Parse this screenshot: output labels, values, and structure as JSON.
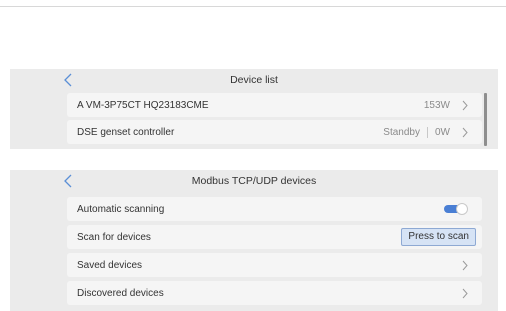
{
  "device_list": {
    "title": "Device list",
    "rows": [
      {
        "label": "A VM-3P75CT HQ23183CME",
        "value": "153W"
      },
      {
        "label": "DSE genset controller",
        "status": "Standby",
        "value": "0W"
      }
    ]
  },
  "modbus": {
    "title": "Modbus TCP/UDP devices",
    "automatic_scanning": {
      "label": "Automatic scanning",
      "enabled": true
    },
    "scan": {
      "label": "Scan for devices",
      "button": "Press to scan"
    },
    "saved": {
      "label": "Saved devices"
    },
    "discovered": {
      "label": "Discovered devices"
    }
  },
  "colors": {
    "accent": "#4a7fd4",
    "panel_bg": "#ebebeb",
    "row_bg": "#f5f5f5"
  },
  "icons": {
    "back": "chevron-left-icon",
    "next": "chevron-right-icon"
  }
}
